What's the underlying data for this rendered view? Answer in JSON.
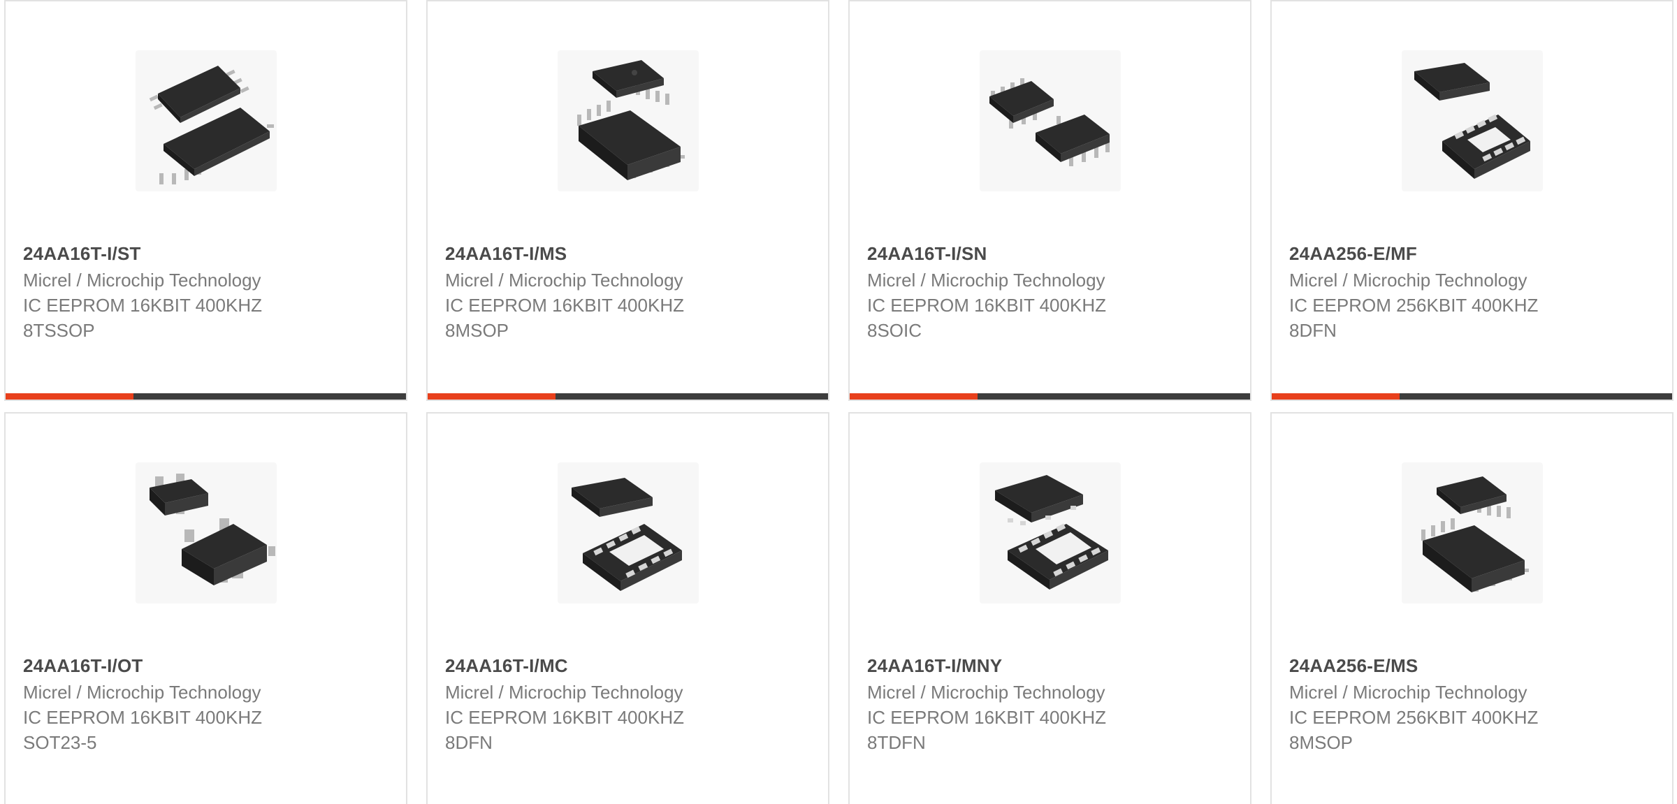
{
  "colors": {
    "accent": "#e8401c",
    "bar": "#3d3d3d",
    "chip": "#2b2b2b",
    "pin": "#b8b8b8"
  },
  "products": [
    {
      "part": "24AA16T-I/ST",
      "manufacturer": "Micrel / Microchip Technology",
      "desc1": "IC EEPROM 16KBIT 400KHZ",
      "desc2": "8TSSOP",
      "icon": "tssop-chip-icon"
    },
    {
      "part": "24AA16T-I/MS",
      "manufacturer": "Micrel / Microchip Technology",
      "desc1": "IC EEPROM 16KBIT 400KHZ",
      "desc2": "8MSOP",
      "icon": "msop-chip-icon"
    },
    {
      "part": "24AA16T-I/SN",
      "manufacturer": "Micrel / Microchip Technology",
      "desc1": "IC EEPROM 16KBIT 400KHZ",
      "desc2": "8SOIC",
      "icon": "soic-chip-icon"
    },
    {
      "part": "24AA256-E/MF",
      "manufacturer": "Micrel / Microchip Technology",
      "desc1": "IC EEPROM 256KBIT 400KHZ",
      "desc2": "8DFN",
      "icon": "dfn-chip-icon"
    },
    {
      "part": "24AA16T-I/OT",
      "manufacturer": "Micrel / Microchip Technology",
      "desc1": "IC EEPROM 16KBIT 400KHZ",
      "desc2": "SOT23-5",
      "icon": "sot23-chip-icon"
    },
    {
      "part": "24AA16T-I/MC",
      "manufacturer": "Micrel / Microchip Technology",
      "desc1": "IC EEPROM 16KBIT 400KHZ",
      "desc2": "8DFN",
      "icon": "dfn-chip-icon"
    },
    {
      "part": "24AA16T-I/MNY",
      "manufacturer": "Micrel / Microchip Technology",
      "desc1": "IC EEPROM 16KBIT 400KHZ",
      "desc2": "8TDFN",
      "icon": "tdfn-chip-icon"
    },
    {
      "part": "24AA256-E/MS",
      "manufacturer": "Micrel / Microchip Technology",
      "desc1": "IC EEPROM 256KBIT 400KHZ",
      "desc2": "8MSOP",
      "icon": "msop-chip-icon"
    }
  ]
}
